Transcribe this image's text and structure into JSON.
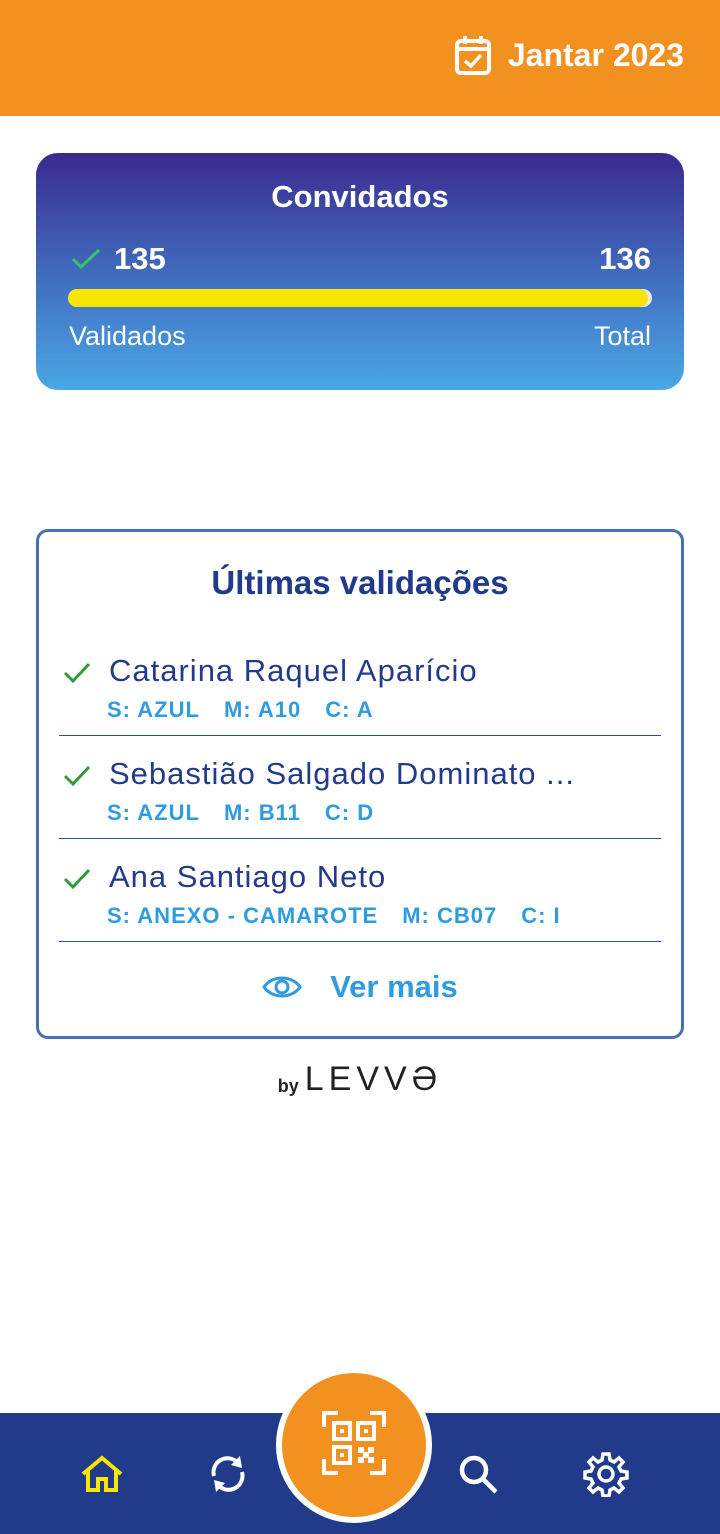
{
  "header": {
    "event_title": "Jantar 2023",
    "icon": "calendar-check-icon",
    "background_color": "#f29120"
  },
  "guests": {
    "title": "Convidados",
    "validated_count": "135",
    "total_count": "136",
    "validated_label": "Validados",
    "total_label": "Total",
    "progress_fraction": 0.9926,
    "progress_color": "#f7e600"
  },
  "recent": {
    "title": "Últimas validações",
    "entries": [
      {
        "name": "Catarina Raquel Aparício",
        "sector": "S: AZUL",
        "table": "M: A10",
        "chair": "C: A"
      },
      {
        "name": "Sebastião Salgado Dominato ...",
        "sector": "S: AZUL",
        "table": "M: B11",
        "chair": "C: D"
      },
      {
        "name": "Ana Santiago Neto",
        "sector": "S: ANEXO - CAMAROTE",
        "table": "M: CB07",
        "chair": "C: I"
      }
    ],
    "see_more_label": "Ver mais",
    "see_more_icon": "eye-icon"
  },
  "branding": {
    "by": "by",
    "name": "LEVVƏ"
  },
  "nav": {
    "items": [
      {
        "icon": "home-icon",
        "active": true
      },
      {
        "icon": "sync-icon",
        "active": false
      },
      {
        "icon": "qr-scan-icon",
        "active": false
      },
      {
        "icon": "search-icon",
        "active": false
      },
      {
        "icon": "settings-icon",
        "active": false
      }
    ],
    "active_color": "#f7e600",
    "background_color": "#223a8a"
  }
}
